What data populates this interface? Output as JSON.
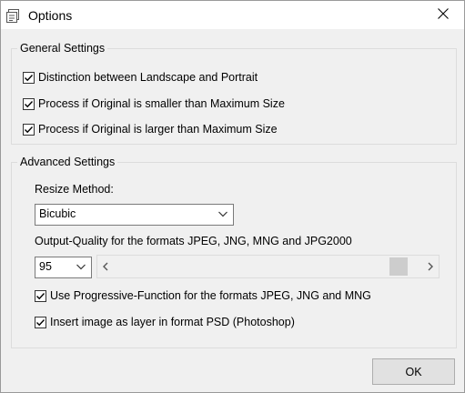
{
  "window": {
    "title": "Options"
  },
  "general": {
    "title": "General Settings",
    "options": [
      {
        "label": "Distinction between Landscape and Portrait",
        "checked": true
      },
      {
        "label": "Process if Original is smaller than Maximum Size",
        "checked": true
      },
      {
        "label": "Process if Original is larger than Maximum Size",
        "checked": true
      }
    ]
  },
  "advanced": {
    "title": "Advanced Settings",
    "resize_label": "Resize Method:",
    "resize_value": "Bicubic",
    "quality_label": "Output-Quality for the formats JPEG, JNG, MNG and JPG2000",
    "quality_value": "95",
    "quality_slider_fraction": 0.95,
    "options": [
      {
        "label": "Use Progressive-Function for the formats JPEG, JNG and MNG",
        "checked": true
      },
      {
        "label": "Insert image as layer in format PSD (Photoshop)",
        "checked": true
      }
    ]
  },
  "buttons": {
    "ok": "OK"
  }
}
